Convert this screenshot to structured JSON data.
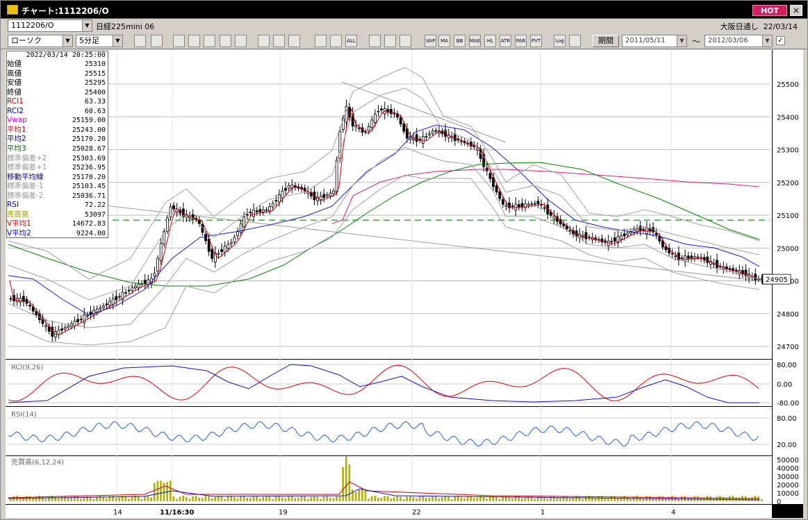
{
  "window": {
    "title": "チャート:1112206/O",
    "hot_label": "HOT",
    "close_label": "×"
  },
  "symbol": {
    "code": "1112206/O",
    "name": "日経225mini 06",
    "market": "大阪日通し",
    "date": "22/03/14"
  },
  "toolbar": {
    "chart_type": "ローソク",
    "period": "5分足",
    "period_button": "期間",
    "date_from": "2011/05/11",
    "date_to": "2012/03/06",
    "separator": "～",
    "icons": [
      "zoom-icon",
      "layout-icon",
      "tools-icon",
      "search-icon",
      "compare-icon",
      "signal-icon",
      "info-icon",
      "trendline-icon",
      "cursor-icon",
      "undo-icon",
      "candle-move-icon",
      "candle-fit-icon",
      "all-icon",
      "settings-icon",
      "pen-icon",
      "palette-icon",
      "vap-icon",
      "ma-icon",
      "bb-icon",
      "mae-icon",
      "hl-icon",
      "atr-icon",
      "par-icon",
      "pvt-icon",
      "log-icon",
      "export-icon"
    ],
    "icon_text": [
      "",
      "",
      "",
      "",
      "",
      "",
      "",
      "",
      "",
      "",
      "",
      "",
      "ALL",
      "",
      "",
      "",
      "VAP",
      "MA",
      "BB",
      "MAE",
      "HL",
      "ATR",
      "PAR",
      "PVT",
      "Log",
      ""
    ]
  },
  "info": {
    "datetime": "2022/03/14  20:25:00",
    "rows": [
      {
        "label": "始値",
        "value": "25310",
        "color": "#000000"
      },
      {
        "label": "高値",
        "value": "25515",
        "color": "#000000"
      },
      {
        "label": "安値",
        "value": "25295",
        "color": "#000000"
      },
      {
        "label": "終値",
        "value": "25400",
        "color": "#000000"
      },
      {
        "label": "RCI1",
        "value": "63.33",
        "color": "#cc0000"
      },
      {
        "label": "RCI2",
        "value": "60.63",
        "color": "#0000cc"
      },
      {
        "label": "Vwap",
        "value": "25159.00",
        "color": "#cc00cc"
      },
      {
        "label": "平均1",
        "value": "25243.00",
        "color": "#cc0000"
      },
      {
        "label": "平均2",
        "value": "25170.20",
        "color": "#000080"
      },
      {
        "label": "平均3",
        "value": "25028.67",
        "color": "#006600"
      },
      {
        "label": "標準偏差+2",
        "value": "25303.69",
        "color": "#999999"
      },
      {
        "label": "標準偏差+1",
        "value": "25236.95",
        "color": "#999999"
      },
      {
        "label": "移動平均線",
        "value": "25170.20",
        "color": "#000080"
      },
      {
        "label": "標準偏差-1",
        "value": "25103.45",
        "color": "#999999"
      },
      {
        "label": "標準偏差-2",
        "value": "25036.71",
        "color": "#999999"
      },
      {
        "label": "RSI",
        "value": "72.22",
        "color": "#0000cc"
      },
      {
        "label": "売買高",
        "value": "53097",
        "color": "#999900"
      },
      {
        "label": "V平均1",
        "value": "14672.83",
        "color": "#cc0000"
      },
      {
        "label": "V平均2",
        "value": "9224.00",
        "color": "#0000cc"
      }
    ]
  },
  "price_axis": {
    "ticks": [
      "25500",
      "25400",
      "25300",
      "25200",
      "25100",
      "25000",
      "24900",
      "24800",
      "24700"
    ],
    "current": "24905"
  },
  "rci_panel": {
    "label": "RCI(9,26)",
    "ticks": [
      "80.00",
      "0.00",
      "-80.00"
    ]
  },
  "rsi_panel": {
    "label": "RSI(14)",
    "ticks": [
      "80.00",
      "20.00"
    ]
  },
  "vol_panel": {
    "label": "売買高(6,12,24)",
    "ticks": [
      "50000",
      "40000",
      "30000",
      "20000",
      "10000",
      "0"
    ]
  },
  "time_axis": {
    "labels": [
      "14",
      "11/16:30",
      "19",
      "22",
      "1",
      "4"
    ]
  },
  "colors": {
    "ma1": "#cc0000",
    "ma2": "#1a1ad0",
    "ma3": "#008000",
    "vwap": "#cc2080",
    "band": "#a0a0a0",
    "rci1": "#dd0000",
    "rci2": "#1010c0",
    "rsi": "#2060e0",
    "volume": "#b0b000",
    "dashed": "#00a000"
  }
}
